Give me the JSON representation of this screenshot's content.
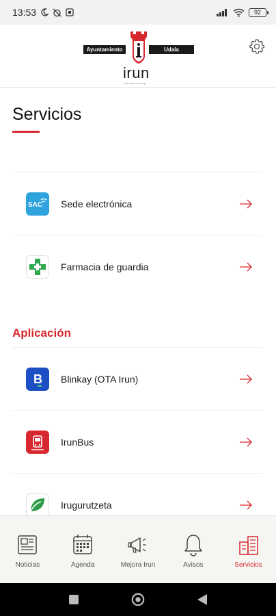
{
  "status_bar": {
    "time": "13:53",
    "battery": "92"
  },
  "header": {
    "logo_left": "Ayuntamiento",
    "logo_right": "Udala",
    "logo_name": "irun",
    "logo_sub": "irun.eus / irun.org"
  },
  "main": {
    "title": "Servicios",
    "services": [
      {
        "label": "Sede electrónica",
        "icon": "sede-electronica-icon"
      },
      {
        "label": "Farmacia de guardia",
        "icon": "pharmacy-cross-icon"
      }
    ],
    "section_title": "Aplicación",
    "apps": [
      {
        "label": "Blinkay (OTA Irun)",
        "icon": "blinkay-icon"
      },
      {
        "label": "IrunBus",
        "icon": "irunbus-icon"
      },
      {
        "label": "Irugurutzeta",
        "icon": "irugurutzeta-icon"
      }
    ]
  },
  "bottom_nav": {
    "items": [
      {
        "label": "Noticias",
        "icon": "newspaper-icon"
      },
      {
        "label": "Agenda",
        "icon": "calendar-icon"
      },
      {
        "label": "Mejora Irun",
        "icon": "megaphone-icon"
      },
      {
        "label": "Avisos",
        "icon": "bell-icon"
      },
      {
        "label": "Servicios",
        "icon": "buildings-icon",
        "active": true
      }
    ]
  },
  "colors": {
    "accent": "#d7282f",
    "nav_bg": "#f5f5f2"
  }
}
